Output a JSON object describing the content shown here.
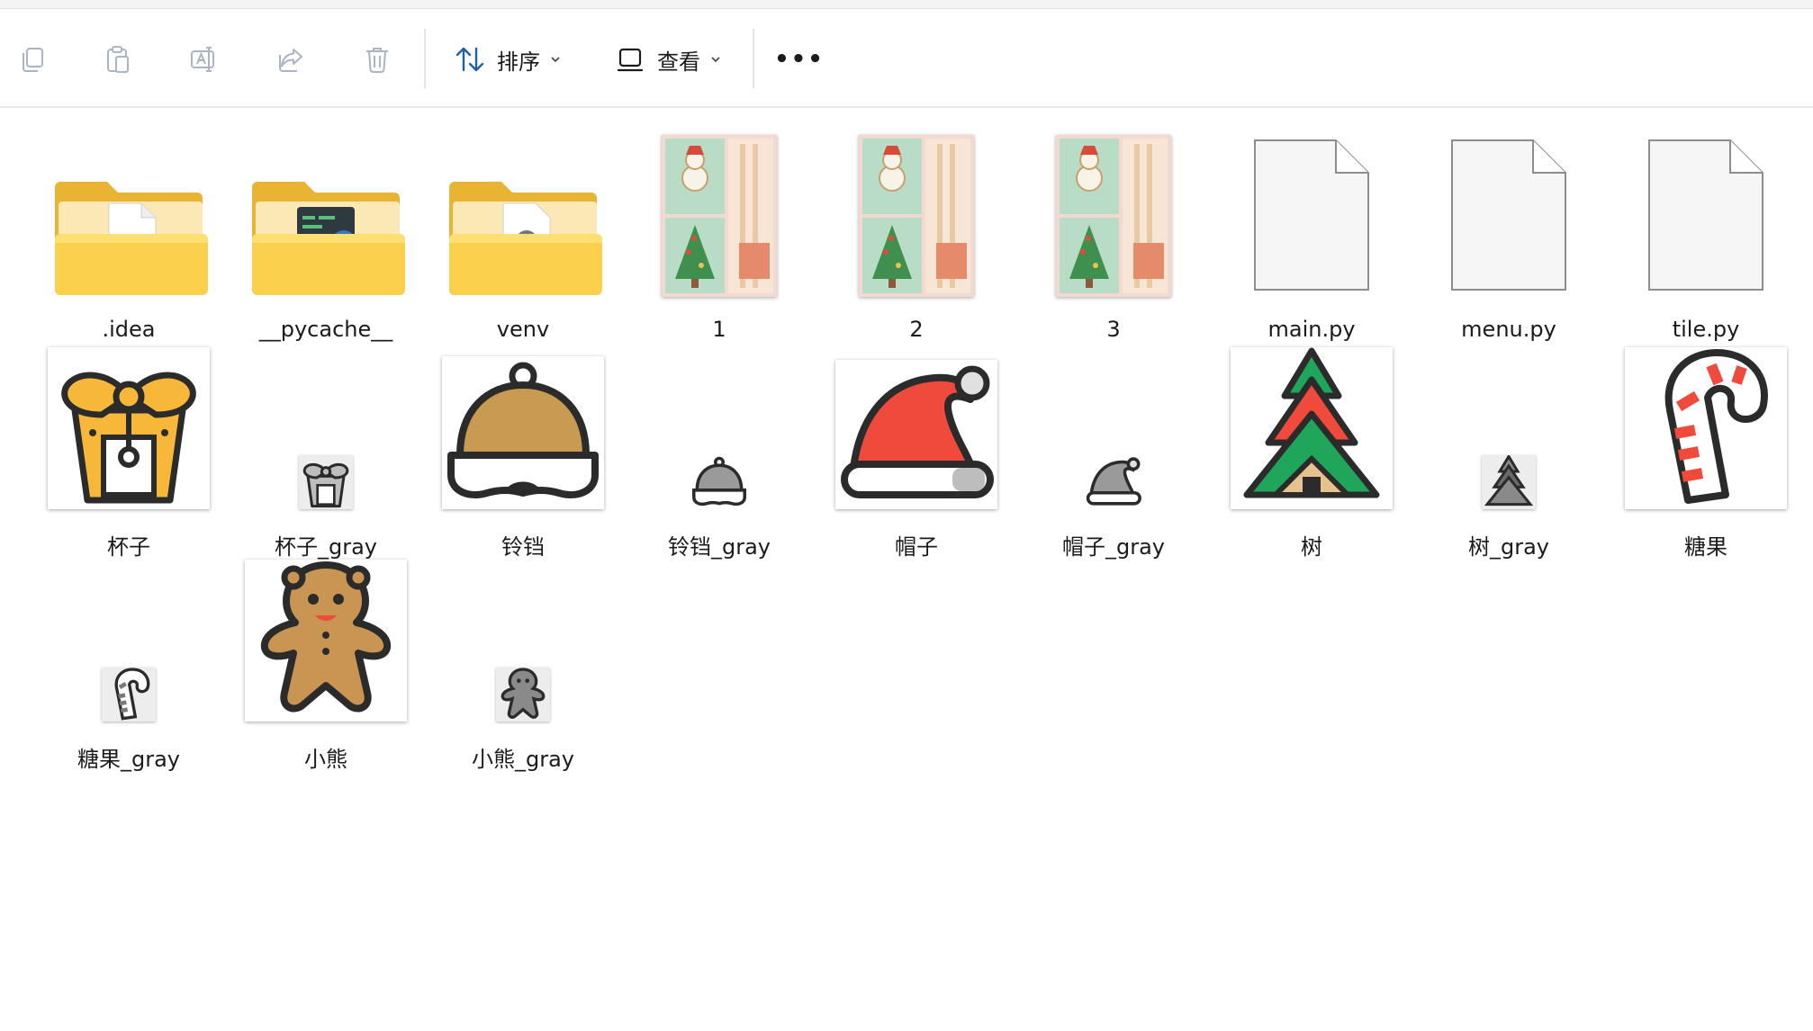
{
  "toolbar": {
    "copy_icon": "copy-icon",
    "paste_icon": "paste-icon",
    "rename_icon": "rename-icon",
    "share_icon": "share-icon",
    "delete_icon": "delete-icon",
    "sort_label": "排序",
    "view_label": "查看",
    "more_label": "•••"
  },
  "files": [
    {
      "name": ".idea",
      "kind": "folder"
    },
    {
      "name": "__pycache__",
      "kind": "folder"
    },
    {
      "name": "venv",
      "kind": "folder"
    },
    {
      "name": "1",
      "kind": "image"
    },
    {
      "name": "2",
      "kind": "image"
    },
    {
      "name": "3",
      "kind": "image"
    },
    {
      "name": "main.py",
      "kind": "file"
    },
    {
      "name": "menu.py",
      "kind": "file"
    },
    {
      "name": "tile.py",
      "kind": "file"
    },
    {
      "name": "杯子",
      "kind": "image"
    },
    {
      "name": "杯子_gray",
      "kind": "image"
    },
    {
      "name": "铃铛",
      "kind": "image"
    },
    {
      "name": "铃铛_gray",
      "kind": "image"
    },
    {
      "name": "帽子",
      "kind": "image"
    },
    {
      "name": "帽子_gray",
      "kind": "image"
    },
    {
      "name": "树",
      "kind": "image"
    },
    {
      "name": "树_gray",
      "kind": "image"
    },
    {
      "name": "糖果",
      "kind": "image"
    },
    {
      "name": "糖果_gray",
      "kind": "image"
    },
    {
      "name": "小熊",
      "kind": "image"
    },
    {
      "name": "小熊_gray",
      "kind": "image"
    }
  ],
  "colors": {
    "folder": "#f7c93f",
    "folder_light": "#fde393",
    "accent_red": "#f15040",
    "accent_green": "#1fa65b",
    "gingerbread": "#c99552",
    "outline": "#2b2b2b"
  }
}
